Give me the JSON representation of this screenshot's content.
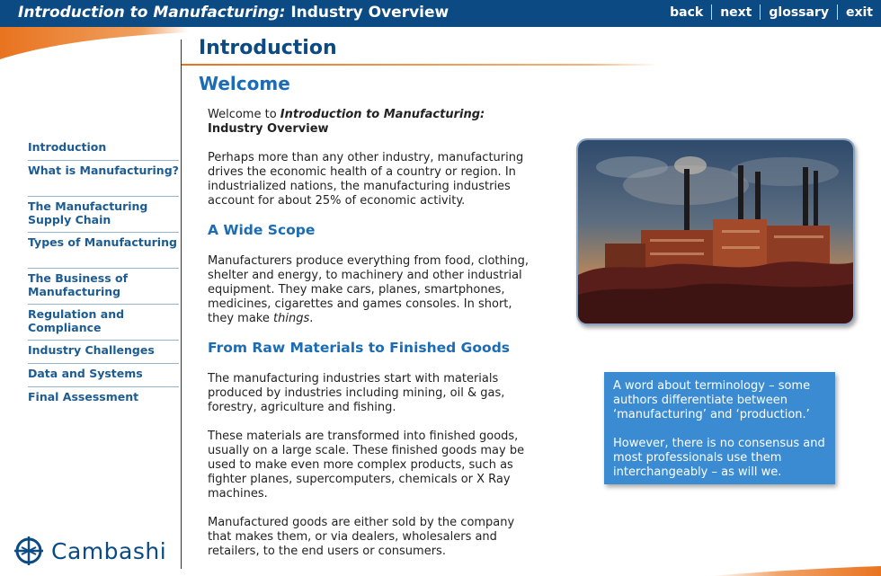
{
  "header": {
    "course_title_italic": "Introduction to Manufacturing:",
    "course_title_rest": " Industry Overview",
    "nav": {
      "back": "back",
      "next": "next",
      "glossary": "glossary",
      "exit": "exit"
    }
  },
  "sidebar": {
    "items": [
      {
        "label": "Introduction"
      },
      {
        "label": "What is Manufacturing?"
      },
      {
        "label": "The Manufacturing Supply Chain"
      },
      {
        "label": "Types of Manufacturing"
      },
      {
        "label": "The Business of Manufacturing"
      },
      {
        "label": "Regulation and Compliance"
      },
      {
        "label": "Industry Challenges"
      },
      {
        "label": "Data and Systems"
      },
      {
        "label": "Final Assessment"
      }
    ],
    "logo_text": "Cambashi"
  },
  "main": {
    "page_title": "Introduction",
    "section_title": "Welcome",
    "welcome_prefix": "Welcome to ",
    "welcome_course": "Introduction to Manufacturing:",
    "welcome_course_2": "Industry Overview",
    "para_1": "Perhaps more than any other industry, manufacturing drives the economic health of a country or region. In industrialized nations, the manufacturing industries account for about 25% of economic activity.",
    "heading_scope": "A Wide Scope",
    "para_scope_a": "Manufacturers produce everything from food, clothing, shelter and energy, to machinery and other industrial equipment. They make cars, planes, smartphones, medicines, cigarettes and games consoles. In short, they make ",
    "para_scope_things": "things",
    "para_scope_end": ".",
    "heading_raw": "From Raw Materials to Finished Goods",
    "para_raw_1": "The manufacturing industries start with materials produced by industries including mining, oil & gas, forestry, agriculture and fishing.",
    "para_raw_2": "These materials are transformed into finished goods, usually on a large scale. These finished goods may be used to make even more complex products, such as fighter planes, supercomputers, chemicals or X Ray machines.",
    "para_raw_3": "Manufactured goods are either sold by the company that makes them, or via dealers, wholesalers and retailers, to the end users or consumers."
  },
  "note": {
    "para_1": "A word about terminology – some authors differentiate between ‘manufacturing’ and ‘production.’",
    "para_2": "However, there is no consensus and most professionals use them interchangeably – as will we."
  },
  "colors": {
    "header_bg": "#0b4a83",
    "accent_orange": "#e8731f",
    "link_blue": "#1c5c93",
    "heading_blue": "#1b6cb4",
    "note_bg": "#3b8bd2"
  }
}
